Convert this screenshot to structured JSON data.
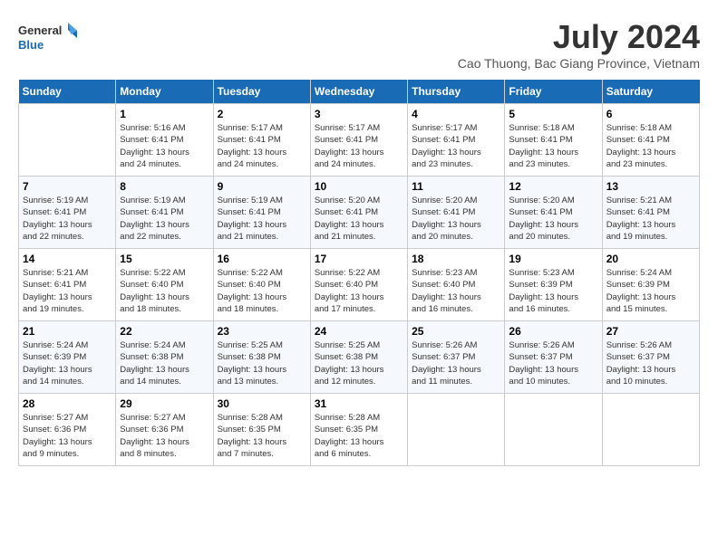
{
  "header": {
    "logo_line1": "General",
    "logo_line2": "Blue",
    "month_title": "July 2024",
    "location": "Cao Thuong, Bac Giang Province, Vietnam"
  },
  "days_of_week": [
    "Sunday",
    "Monday",
    "Tuesday",
    "Wednesday",
    "Thursday",
    "Friday",
    "Saturday"
  ],
  "weeks": [
    [
      {
        "day": "",
        "info": ""
      },
      {
        "day": "1",
        "info": "Sunrise: 5:16 AM\nSunset: 6:41 PM\nDaylight: 13 hours\nand 24 minutes."
      },
      {
        "day": "2",
        "info": "Sunrise: 5:17 AM\nSunset: 6:41 PM\nDaylight: 13 hours\nand 24 minutes."
      },
      {
        "day": "3",
        "info": "Sunrise: 5:17 AM\nSunset: 6:41 PM\nDaylight: 13 hours\nand 24 minutes."
      },
      {
        "day": "4",
        "info": "Sunrise: 5:17 AM\nSunset: 6:41 PM\nDaylight: 13 hours\nand 23 minutes."
      },
      {
        "day": "5",
        "info": "Sunrise: 5:18 AM\nSunset: 6:41 PM\nDaylight: 13 hours\nand 23 minutes."
      },
      {
        "day": "6",
        "info": "Sunrise: 5:18 AM\nSunset: 6:41 PM\nDaylight: 13 hours\nand 23 minutes."
      }
    ],
    [
      {
        "day": "7",
        "info": "Sunrise: 5:19 AM\nSunset: 6:41 PM\nDaylight: 13 hours\nand 22 minutes."
      },
      {
        "day": "8",
        "info": "Sunrise: 5:19 AM\nSunset: 6:41 PM\nDaylight: 13 hours\nand 22 minutes."
      },
      {
        "day": "9",
        "info": "Sunrise: 5:19 AM\nSunset: 6:41 PM\nDaylight: 13 hours\nand 21 minutes."
      },
      {
        "day": "10",
        "info": "Sunrise: 5:20 AM\nSunset: 6:41 PM\nDaylight: 13 hours\nand 21 minutes."
      },
      {
        "day": "11",
        "info": "Sunrise: 5:20 AM\nSunset: 6:41 PM\nDaylight: 13 hours\nand 20 minutes."
      },
      {
        "day": "12",
        "info": "Sunrise: 5:20 AM\nSunset: 6:41 PM\nDaylight: 13 hours\nand 20 minutes."
      },
      {
        "day": "13",
        "info": "Sunrise: 5:21 AM\nSunset: 6:41 PM\nDaylight: 13 hours\nand 19 minutes."
      }
    ],
    [
      {
        "day": "14",
        "info": "Sunrise: 5:21 AM\nSunset: 6:41 PM\nDaylight: 13 hours\nand 19 minutes."
      },
      {
        "day": "15",
        "info": "Sunrise: 5:22 AM\nSunset: 6:40 PM\nDaylight: 13 hours\nand 18 minutes."
      },
      {
        "day": "16",
        "info": "Sunrise: 5:22 AM\nSunset: 6:40 PM\nDaylight: 13 hours\nand 18 minutes."
      },
      {
        "day": "17",
        "info": "Sunrise: 5:22 AM\nSunset: 6:40 PM\nDaylight: 13 hours\nand 17 minutes."
      },
      {
        "day": "18",
        "info": "Sunrise: 5:23 AM\nSunset: 6:40 PM\nDaylight: 13 hours\nand 16 minutes."
      },
      {
        "day": "19",
        "info": "Sunrise: 5:23 AM\nSunset: 6:39 PM\nDaylight: 13 hours\nand 16 minutes."
      },
      {
        "day": "20",
        "info": "Sunrise: 5:24 AM\nSunset: 6:39 PM\nDaylight: 13 hours\nand 15 minutes."
      }
    ],
    [
      {
        "day": "21",
        "info": "Sunrise: 5:24 AM\nSunset: 6:39 PM\nDaylight: 13 hours\nand 14 minutes."
      },
      {
        "day": "22",
        "info": "Sunrise: 5:24 AM\nSunset: 6:38 PM\nDaylight: 13 hours\nand 14 minutes."
      },
      {
        "day": "23",
        "info": "Sunrise: 5:25 AM\nSunset: 6:38 PM\nDaylight: 13 hours\nand 13 minutes."
      },
      {
        "day": "24",
        "info": "Sunrise: 5:25 AM\nSunset: 6:38 PM\nDaylight: 13 hours\nand 12 minutes."
      },
      {
        "day": "25",
        "info": "Sunrise: 5:26 AM\nSunset: 6:37 PM\nDaylight: 13 hours\nand 11 minutes."
      },
      {
        "day": "26",
        "info": "Sunrise: 5:26 AM\nSunset: 6:37 PM\nDaylight: 13 hours\nand 10 minutes."
      },
      {
        "day": "27",
        "info": "Sunrise: 5:26 AM\nSunset: 6:37 PM\nDaylight: 13 hours\nand 10 minutes."
      }
    ],
    [
      {
        "day": "28",
        "info": "Sunrise: 5:27 AM\nSunset: 6:36 PM\nDaylight: 13 hours\nand 9 minutes."
      },
      {
        "day": "29",
        "info": "Sunrise: 5:27 AM\nSunset: 6:36 PM\nDaylight: 13 hours\nand 8 minutes."
      },
      {
        "day": "30",
        "info": "Sunrise: 5:28 AM\nSunset: 6:35 PM\nDaylight: 13 hours\nand 7 minutes."
      },
      {
        "day": "31",
        "info": "Sunrise: 5:28 AM\nSunset: 6:35 PM\nDaylight: 13 hours\nand 6 minutes."
      },
      {
        "day": "",
        "info": ""
      },
      {
        "day": "",
        "info": ""
      },
      {
        "day": "",
        "info": ""
      }
    ]
  ]
}
